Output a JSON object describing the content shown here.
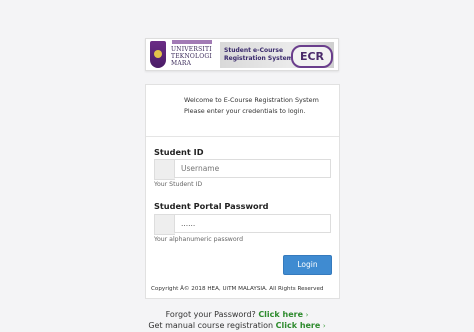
{
  "banner": {
    "uni_lines": [
      "UNIVERSITI",
      "TEKNOLOGI",
      "MARA"
    ],
    "ecr_title_line1": "Student e-Course",
    "ecr_title_line2": "Registration System",
    "ecr_badge": "ECR"
  },
  "card": {
    "welcome": "Welcome to E-Course Registration System Please enter your credentials to login.",
    "student_id": {
      "label": "Student ID",
      "placeholder": "Username",
      "help": "Your Student ID"
    },
    "password": {
      "label": "Student Portal Password",
      "value": "......",
      "help": "Your alphanumeric password"
    },
    "login_label": "Login",
    "copyright": "Copyright Â© 2018 HEA, UiTM MALAYSIA. All Rights Reserved"
  },
  "footer": {
    "forgot_text": "Forgot your Password?",
    "forgot_link": "Click here",
    "manual_text": "Get manual course registration",
    "manual_link": "Click here",
    "arrow": "›"
  }
}
